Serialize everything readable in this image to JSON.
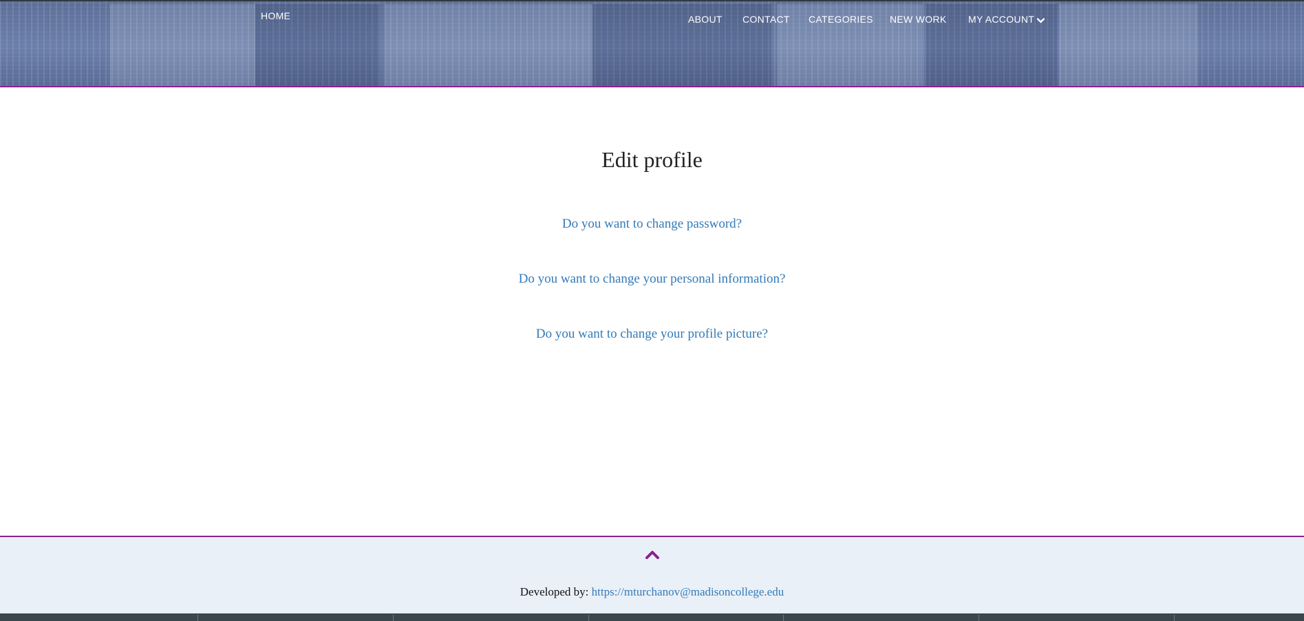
{
  "nav": {
    "home": "HOME",
    "about": "ABOUT",
    "contact": "CONTACT",
    "categories": "CATEGORIES",
    "new_work": "NEW WORK",
    "my_account": "MY ACCOUNT",
    "my_account_icon": "chevron-down-icon"
  },
  "main": {
    "title": "Edit profile",
    "options": [
      "Do you want to change password?",
      "Do you want to change your personal information?",
      "Do you want to change your profile picture?"
    ]
  },
  "footer": {
    "scroll_top_icon": "chevron-up-icon",
    "developed_by_label": "Developed by:",
    "developer_link": "https://mturchanov@madisoncollege.edu"
  },
  "colors": {
    "accent": "#8b1f8f",
    "link": "#337ab7",
    "header_bg": "#6477a2",
    "footer_bg": "#eaf0f8"
  }
}
